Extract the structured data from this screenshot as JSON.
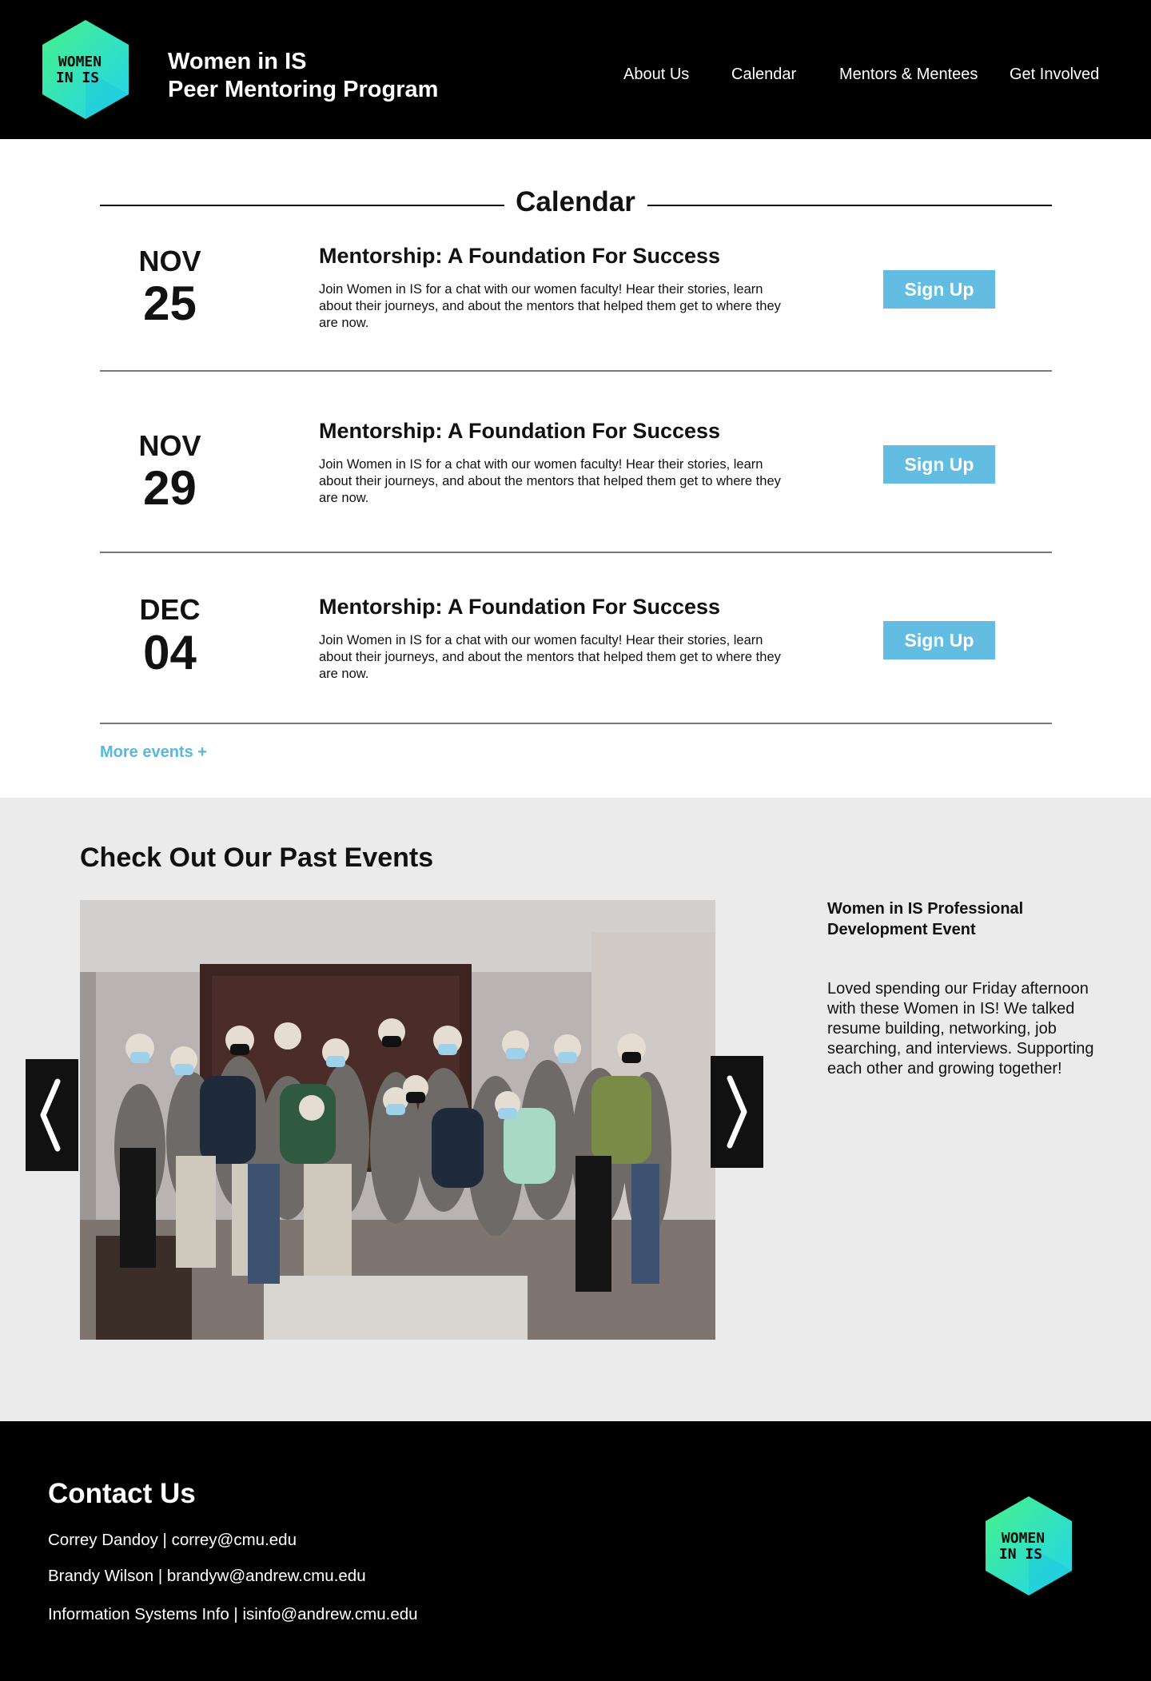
{
  "header": {
    "brand_line1": "Women in IS",
    "brand_line2": "Peer Mentoring Program",
    "logo_text_line1": "WOMEN",
    "logo_text_line2": "IN IS",
    "nav": [
      "About Us",
      "Calendar",
      "Mentors & Mentees",
      "Get Involved"
    ]
  },
  "calendar": {
    "title": "Calendar",
    "events": [
      {
        "month": "NOV",
        "day": "25",
        "title": "Mentorship: A Foundation For Success",
        "description": "Join Women in IS for a chat with our women faculty! Hear their stories, learn about their journeys, and about the mentors that helped them get to where they are now.",
        "button": "Sign Up"
      },
      {
        "month": "NOV",
        "day": "29",
        "title": "Mentorship: A Foundation For Success",
        "description": "Join Women in IS for a chat with our women faculty! Hear their stories, learn about their journeys, and about the mentors that helped them get to where they are now.",
        "button": "Sign Up"
      },
      {
        "month": "DEC",
        "day": "04",
        "title": "Mentorship: A Foundation For Success",
        "description": "Join Women in IS for a chat with our women faculty! Hear their stories, learn about their journeys, and about the mentors that helped them get to where they are now.",
        "button": "Sign Up"
      }
    ],
    "more_link": "More events +"
  },
  "past_events": {
    "title": "Check Out Our Past Events",
    "caption_title": "Women in IS Professional Development Event",
    "caption_text": "Loved spending our Friday afternoon with these Women in IS! We talked resume building, networking, job searching, and interviews. Supporting each other and growing together!",
    "prev_icon": "chevron-left-icon",
    "next_icon": "chevron-right-icon"
  },
  "footer": {
    "title": "Contact Us",
    "contacts": [
      "Correy Dandoy | correy@cmu.edu",
      "Brandy Wilson | brandyw@andrew.cmu.edu",
      "Information Systems Info | isinfo@andrew.cmu.edu"
    ]
  },
  "colors": {
    "accent_blue": "#63bde3",
    "link_blue": "#5ab8dd",
    "logo_green": "#3ee89a",
    "logo_cyan": "#2fd6e8",
    "header_bg": "#000000",
    "section_gray": "#ebebeb"
  }
}
